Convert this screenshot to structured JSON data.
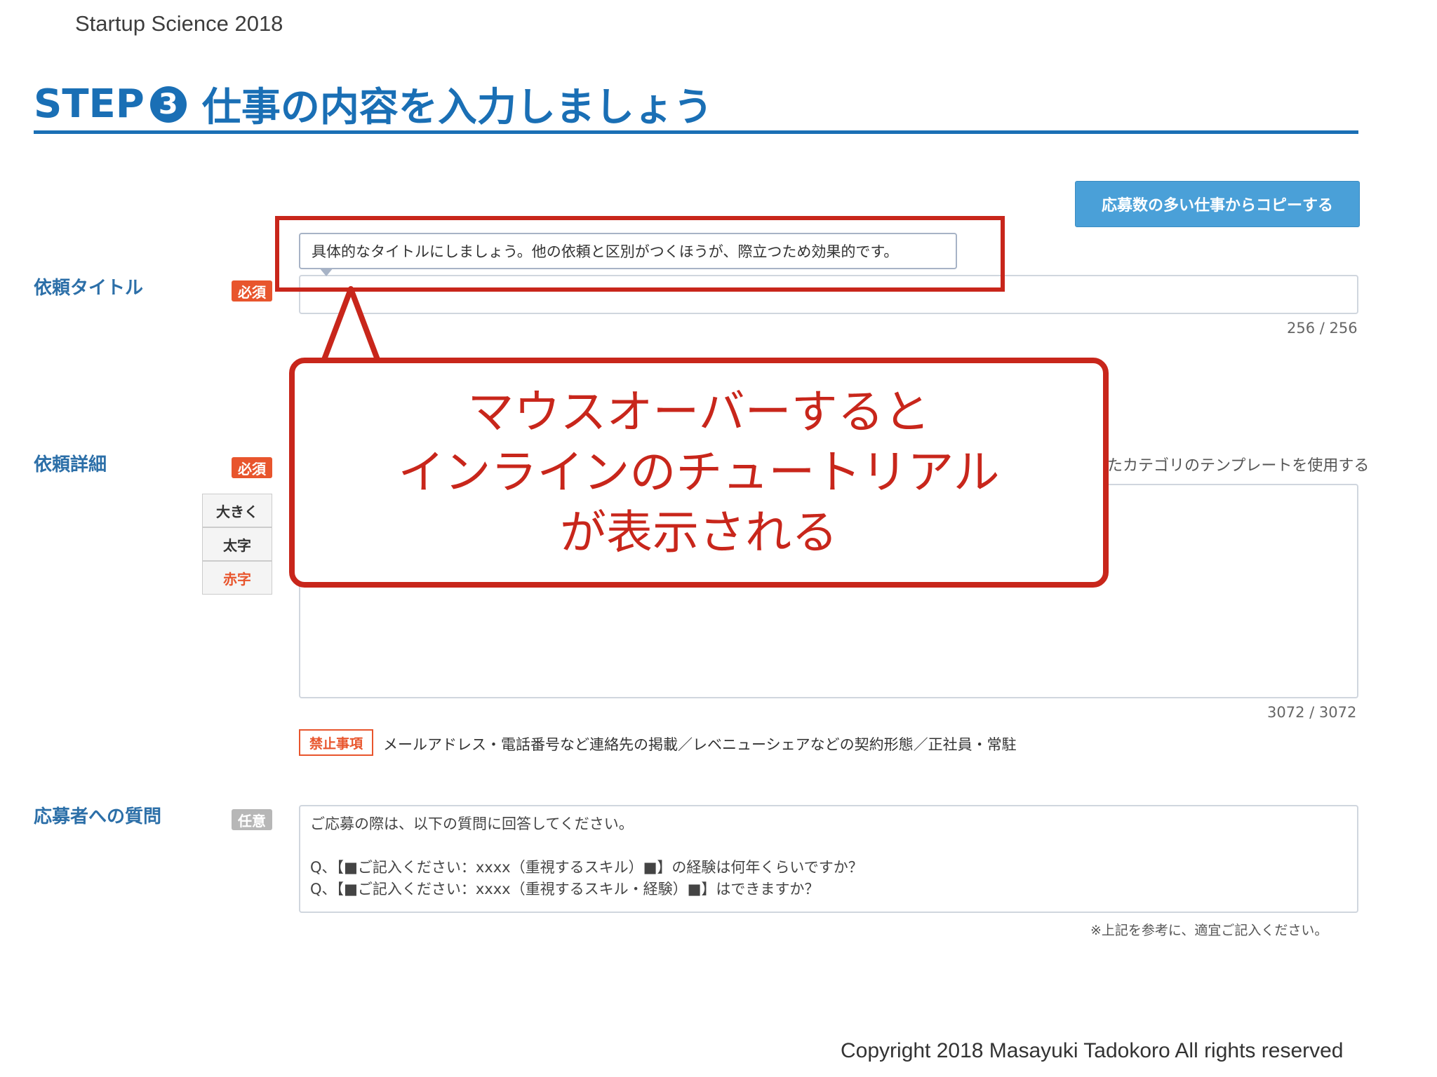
{
  "header": {
    "deck_label": "Startup Science 2018",
    "step_prefix": "STEP",
    "step_number": "3",
    "step_title": "仕事の内容を入力しましょう"
  },
  "copy_button_label": "応募数の多い仕事からコピーする",
  "tooltip_text": "具体的なタイトルにしましょう。他の依頼と区別がつくほうが、際立つため効果的です。",
  "fields": {
    "title": {
      "label": "依頼タイトル",
      "badge": "必須",
      "counter": "256 / 256"
    },
    "detail": {
      "label": "依頼詳細",
      "badge": "必須",
      "template_link": "たカテゴリのテンプレートを使用する",
      "counter": "3072 / 3072",
      "editor_buttons": [
        "大きく",
        "太字",
        "赤字"
      ]
    },
    "question": {
      "label": "応募者への質問",
      "badge": "任意",
      "lines": [
        "ご応募の際は、以下の質問に回答してください。",
        "",
        "Q、【■ご記入ください：xxxx（重視するスキル）■】の経験は何年くらいですか？",
        "Q、【■ご記入ください：xxxx（重視するスキル・経験）■】はできますか？"
      ],
      "note": "※上記を参考に、適宜ご記入ください。"
    }
  },
  "prohibited": {
    "badge": "禁止事項",
    "text": "メールアドレス・電話番号など連絡先の掲載／レベニューシェアなどの契約形態／正社員・常駐"
  },
  "callout": {
    "lines": [
      "マウスオーバーすると",
      "インラインのチュートリアル",
      "が表示される"
    ]
  },
  "footer": {
    "copyright": "Copyright 2018 Masayuki Tadokoro All rights reserved"
  },
  "colors": {
    "brand_blue": "#1a6fb5",
    "label_blue": "#2c6fa8",
    "button_blue": "#4aa0d8",
    "required_orange": "#e8552d",
    "optional_gray": "#b7b7b7",
    "callout_red": "#c8261b"
  }
}
